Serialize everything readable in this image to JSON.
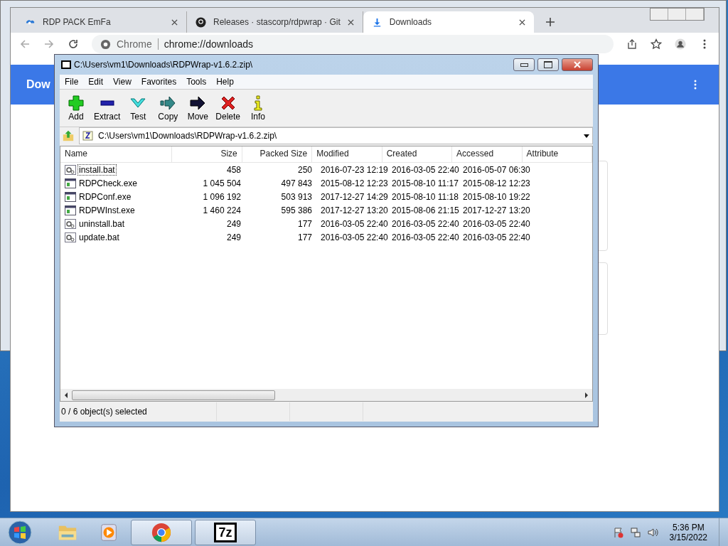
{
  "browser": {
    "tabs": [
      {
        "title": "RDP PACK EmFa",
        "kind": "cloud",
        "selected": false
      },
      {
        "title": "Releases · stascorp/rdpwrap · Git",
        "kind": "github",
        "selected": false
      },
      {
        "title": "Downloads",
        "kind": "download",
        "selected": true
      }
    ],
    "address": {
      "site": "Chrome",
      "url": "chrome://downloads"
    },
    "header": "Dow"
  },
  "archiver": {
    "title": "C:\\Users\\vm1\\Downloads\\RDPWrap-v1.6.2.zip\\",
    "menu": [
      "File",
      "Edit",
      "View",
      "Favorites",
      "Tools",
      "Help"
    ],
    "toolbar": [
      {
        "label": "Add",
        "kind": "add"
      },
      {
        "label": "Extract",
        "kind": "extract"
      },
      {
        "label": "Test",
        "kind": "test"
      },
      {
        "label": "Copy",
        "kind": "copy"
      },
      {
        "label": "Move",
        "kind": "move"
      },
      {
        "label": "Delete",
        "kind": "delete"
      },
      {
        "label": "Info",
        "kind": "info"
      }
    ],
    "path": "C:\\Users\\vm1\\Downloads\\RDPWrap-v1.6.2.zip\\",
    "columns": [
      "Name",
      "Size",
      "Packed Size",
      "Modified",
      "Created",
      "Accessed",
      "Attribute"
    ],
    "rows": [
      {
        "kind": "bat",
        "name": "install.bat",
        "size": "458",
        "packed": "250",
        "modified": "2016-07-23 12:19",
        "created": "2016-03-05 22:40",
        "accessed": "2016-05-07 06:30",
        "selected": false,
        "focused": true
      },
      {
        "kind": "exe",
        "name": "RDPCheck.exe",
        "size": "1 045 504",
        "packed": "497 843",
        "modified": "2015-08-12 12:23",
        "created": "2015-08-10 11:17",
        "accessed": "2015-08-12 12:23",
        "selected": false,
        "focused": false
      },
      {
        "kind": "exe",
        "name": "RDPConf.exe",
        "size": "1 096 192",
        "packed": "503 913",
        "modified": "2017-12-27 14:29",
        "created": "2015-08-10 11:18",
        "accessed": "2015-08-10 19:22",
        "selected": false,
        "focused": false
      },
      {
        "kind": "exe",
        "name": "RDPWInst.exe",
        "size": "1 460 224",
        "packed": "595 386",
        "modified": "2017-12-27 13:20",
        "created": "2015-08-06 21:15",
        "accessed": "2017-12-27 13:20",
        "selected": false,
        "focused": false
      },
      {
        "kind": "bat",
        "name": "uninstall.bat",
        "size": "249",
        "packed": "177",
        "modified": "2016-03-05 22:40",
        "created": "2016-03-05 22:40",
        "accessed": "2016-03-05 22:40",
        "selected": false,
        "focused": false
      },
      {
        "kind": "bat",
        "name": "update.bat",
        "size": "249",
        "packed": "177",
        "modified": "2016-03-05 22:40",
        "created": "2016-03-05 22:40",
        "accessed": "2016-03-05 22:40",
        "selected": false,
        "focused": false
      }
    ],
    "status": "0 / 6 object(s) selected"
  },
  "taskbar": {
    "apps": [
      {
        "kind": "explorer",
        "active": false
      },
      {
        "kind": "media",
        "active": false
      },
      {
        "kind": "chrome",
        "active": true
      },
      {
        "kind": "sevenzip",
        "active": true,
        "label": "7z"
      }
    ],
    "time": "5:36 PM",
    "date": "3/15/2022"
  }
}
